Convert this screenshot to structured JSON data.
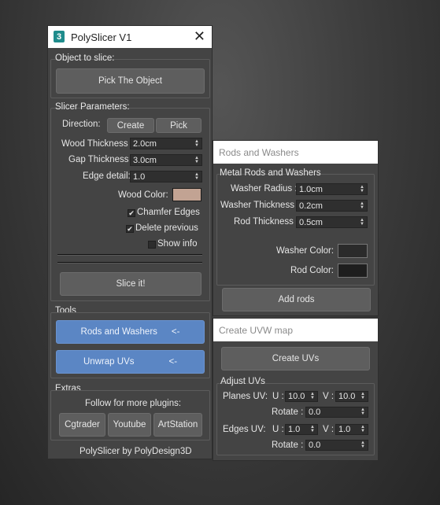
{
  "main": {
    "title": "PolySlicer V1",
    "object_group": {
      "title": "Object to slice:",
      "pick_button": "Pick The Object"
    },
    "params_group": {
      "title": "Slicer Parameters:",
      "direction_label": "Direction:",
      "create_button": "Create",
      "pick_button": "Pick",
      "wood_thickness_label": "Wood Thickness :",
      "wood_thickness_value": "2.0cm",
      "gap_thickness_label": "Gap Thickness :",
      "gap_thickness_value": "3.0cm",
      "edge_detail_label": "Edge detail:",
      "edge_detail_value": "1.0",
      "wood_color_label": "Wood Color:",
      "wood_color": "#c2a393",
      "chamfer_label": "Chamfer Edges",
      "chamfer_checked": "✔",
      "delete_label": "Delete previous",
      "delete_checked": "✔",
      "show_info_label": "Show info",
      "slice_button": "Slice it!"
    },
    "tools": {
      "title": "Tools",
      "rods_button": "Rods and Washers",
      "rods_arrow": "<-",
      "unwrap_button": "Unwrap UVs",
      "unwrap_arrow": "<-"
    },
    "extras": {
      "title": "Extras",
      "follow_text": "Follow for more plugins:",
      "cgtrader": "Cgtrader",
      "youtube": "Youtube",
      "artstation": "ArtStation"
    },
    "footer": "PolySlicer by PolyDesign3D"
  },
  "rods": {
    "header": "Rods and Washers",
    "group_title": "Metal Rods and Washers",
    "washer_radius_label": "Washer Radius :",
    "washer_radius_value": "1.0cm",
    "washer_thickness_label": "Washer Thickness :",
    "washer_thickness_value": "0.2cm",
    "rod_thickness_label": "Rod Thickness :",
    "rod_thickness_value": "0.5cm",
    "washer_color_label": "Washer Color:",
    "washer_color": "#2b2b2b",
    "rod_color_label": "Rod Color:",
    "rod_color": "#1e1e1e",
    "add_button": "Add rods"
  },
  "uvw": {
    "header": "Create UVW map",
    "create_button": "Create UVs",
    "adjust_title": "Adjust UVs",
    "planes_label": "Planes UV:",
    "edges_label": "Edges UV:",
    "u_label": "U :",
    "v_label": "V :",
    "rotate_label": "Rotate :",
    "planes_u": "10.0",
    "planes_v": "10.0",
    "planes_rotate": "0.0",
    "edges_u": "1.0",
    "edges_v": "1.0",
    "edges_rotate": "0.0"
  }
}
